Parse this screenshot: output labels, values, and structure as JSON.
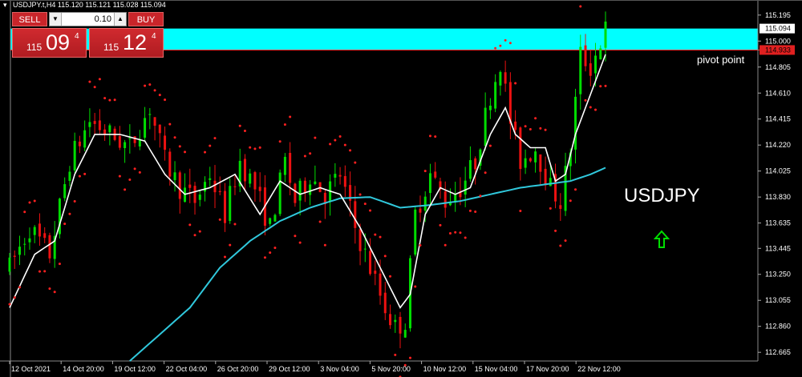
{
  "window": {
    "symbol_header": "USDJPY.t,H4  115.120 115.121 115.028 115.094"
  },
  "trade_panel": {
    "sell_label": "SELL",
    "buy_label": "BUY",
    "lot_value": "0.10",
    "sell_price": {
      "prefix": "115",
      "big": "09",
      "sup": "4"
    },
    "buy_price": {
      "prefix": "115",
      "big": "12",
      "sup": "4"
    }
  },
  "annotations": {
    "pivot_label": "pivot point",
    "symbol_label": "USDJPY"
  },
  "colors": {
    "background": "#000000",
    "bull_candle": "#00dd00",
    "bear_candle": "#ee1111",
    "zone": "#00ffff",
    "ma_fast": "#ffffff",
    "ma_slow": "#30c8dc",
    "psar": "#ff2020",
    "arrow": "#00dd00"
  },
  "chart_data": {
    "type": "candlestick",
    "ylim": [
      112.6,
      115.26
    ],
    "y_ticks": [
      "115.195",
      "115.000",
      "114.805",
      "114.610",
      "114.415",
      "114.220",
      "114.025",
      "113.830",
      "113.635",
      "113.445",
      "113.250",
      "113.055",
      "112.860",
      "112.665"
    ],
    "y_tick_values": [
      115.195,
      115.0,
      114.805,
      114.61,
      114.415,
      114.22,
      114.025,
      113.83,
      113.635,
      113.445,
      113.25,
      113.055,
      112.86,
      112.665
    ],
    "current_price": {
      "label": "115.094",
      "value": 115.094
    },
    "pivot_price": {
      "label": "114.933",
      "value": 114.933
    },
    "zone": {
      "from": 114.933,
      "to": 115.094
    },
    "x_ticks": [
      "12 Oct 2021",
      "14 Oct 20:00",
      "19 Oct 12:00",
      "22 Oct 04:00",
      "26 Oct 20:00",
      "29 Oct 12:00",
      "3 Nov 04:00",
      "5 Nov 20:00",
      "10 Nov 12:00",
      "15 Nov 04:00",
      "17 Nov 20:00",
      "22 Nov 12:00"
    ],
    "bar_count": 120,
    "close_path": [
      [
        0,
        113.3
      ],
      [
        4,
        113.6
      ],
      [
        8,
        113.4
      ],
      [
        12,
        114.1
      ],
      [
        16,
        114.4
      ],
      [
        20,
        114.3
      ],
      [
        24,
        114.2
      ],
      [
        28,
        114.5
      ],
      [
        31,
        114.1
      ],
      [
        34,
        113.9
      ],
      [
        37,
        113.8
      ],
      [
        40,
        114.0
      ],
      [
        43,
        113.7
      ],
      [
        46,
        114.1
      ],
      [
        49,
        113.9
      ],
      [
        52,
        113.6
      ],
      [
        55,
        114.1
      ],
      [
        57,
        113.8
      ],
      [
        60,
        114.0
      ],
      [
        63,
        113.85
      ],
      [
        66,
        114.0
      ],
      [
        69,
        113.6
      ],
      [
        72,
        113.3
      ],
      [
        75,
        113.0
      ],
      [
        77,
        112.85
      ],
      [
        79,
        112.9
      ],
      [
        81,
        113.7
      ],
      [
        84,
        114.0
      ],
      [
        87,
        113.8
      ],
      [
        90,
        113.9
      ],
      [
        93,
        114.1
      ],
      [
        96,
        114.6
      ],
      [
        98,
        114.85
      ],
      [
        100,
        114.4
      ],
      [
        102,
        114.1
      ],
      [
        105,
        114.2
      ],
      [
        108,
        113.9
      ],
      [
        110,
        113.8
      ],
      [
        112,
        114.2
      ],
      [
        114,
        114.9
      ],
      [
        116,
        114.8
      ],
      [
        119,
        115.09
      ]
    ],
    "ma_fast_path": [
      [
        0,
        113.0
      ],
      [
        5,
        113.4
      ],
      [
        9,
        113.5
      ],
      [
        13,
        114.0
      ],
      [
        17,
        114.3
      ],
      [
        22,
        114.3
      ],
      [
        27,
        114.25
      ],
      [
        31,
        114.0
      ],
      [
        35,
        113.85
      ],
      [
        40,
        113.9
      ],
      [
        45,
        114.0
      ],
      [
        50,
        113.7
      ],
      [
        54,
        113.95
      ],
      [
        58,
        113.85
      ],
      [
        62,
        113.9
      ],
      [
        66,
        113.85
      ],
      [
        70,
        113.6
      ],
      [
        74,
        113.3
      ],
      [
        78,
        113.0
      ],
      [
        80,
        113.1
      ],
      [
        83,
        113.7
      ],
      [
        86,
        113.9
      ],
      [
        89,
        113.85
      ],
      [
        92,
        113.9
      ],
      [
        96,
        114.3
      ],
      [
        99,
        114.5
      ],
      [
        101,
        114.3
      ],
      [
        104,
        114.2
      ],
      [
        107,
        114.2
      ],
      [
        109,
        113.95
      ],
      [
        111,
        114.0
      ],
      [
        113,
        114.3
      ],
      [
        116,
        114.6
      ],
      [
        119,
        114.9
      ]
    ],
    "ma_slow_path": [
      [
        24,
        112.6
      ],
      [
        30,
        112.8
      ],
      [
        36,
        113.0
      ],
      [
        42,
        113.3
      ],
      [
        48,
        113.5
      ],
      [
        54,
        113.65
      ],
      [
        60,
        113.75
      ],
      [
        66,
        113.82
      ],
      [
        72,
        113.83
      ],
      [
        78,
        113.75
      ],
      [
        84,
        113.77
      ],
      [
        90,
        113.8
      ],
      [
        96,
        113.85
      ],
      [
        102,
        113.9
      ],
      [
        108,
        113.93
      ],
      [
        112,
        113.95
      ],
      [
        116,
        114.0
      ],
      [
        119,
        114.05
      ]
    ]
  }
}
